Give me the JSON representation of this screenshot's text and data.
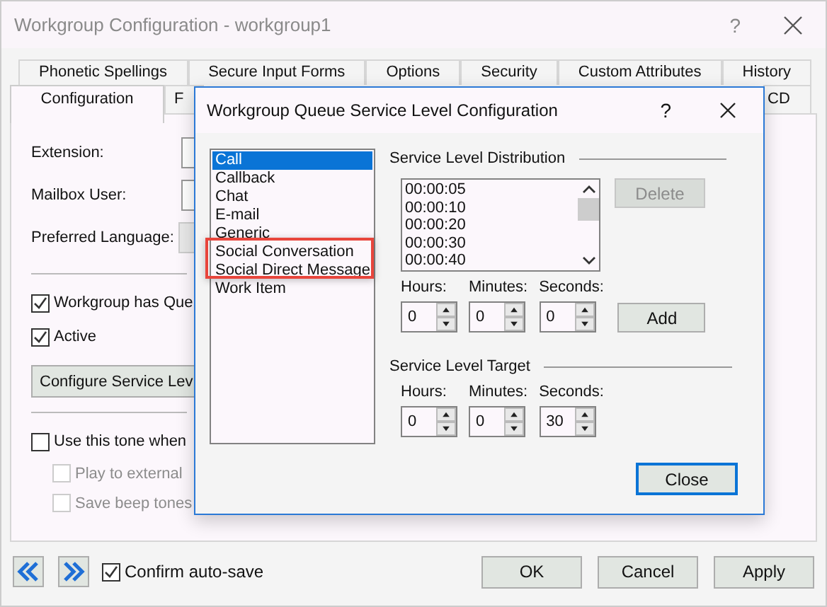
{
  "window": {
    "title": "Workgroup Configuration - workgroup1",
    "help": "?"
  },
  "tabs_row_1": [
    {
      "label": "Phonetic Spellings",
      "selected": false
    },
    {
      "label": "Secure Input Forms",
      "selected": false
    },
    {
      "label": "Options",
      "selected": false
    },
    {
      "label": "Security",
      "selected": false
    },
    {
      "label": "Custom Attributes",
      "selected": false
    },
    {
      "label": "History",
      "selected": false
    }
  ],
  "tabs_row_2": [
    {
      "label": "Configuration",
      "selected": true
    },
    {
      "label": "F",
      "selected": false
    },
    {
      "label": "CD",
      "selected": false
    }
  ],
  "form": {
    "fields": [
      {
        "label": "Extension:",
        "kind": "text"
      },
      {
        "label": "Mailbox User:",
        "kind": "text"
      },
      {
        "label": "Preferred Language:",
        "kind": "dropdown"
      }
    ],
    "checks": [
      {
        "label": "Workgroup has Que",
        "checked": true
      },
      {
        "label": "Active",
        "checked": true
      }
    ],
    "configure_button": "Configure Service Lev",
    "tone": {
      "label": "Use this tone when",
      "checked": false,
      "children": [
        {
          "label": "Play to external",
          "checked": false,
          "disabled": true
        },
        {
          "label": "Save beep tones",
          "checked": false,
          "disabled": true
        }
      ]
    }
  },
  "footer": {
    "confirm_autosave": {
      "label": "Confirm auto-save",
      "checked": true
    },
    "buttons": [
      {
        "label": "OK"
      },
      {
        "label": "Cancel"
      },
      {
        "label": "Apply"
      }
    ]
  },
  "dialog": {
    "title": "Workgroup Queue Service Level Configuration",
    "help": "?",
    "interaction_types": [
      {
        "label": "Call",
        "selected": true
      },
      {
        "label": "Callback",
        "selected": false
      },
      {
        "label": "Chat",
        "selected": false
      },
      {
        "label": "E-mail",
        "selected": false
      },
      {
        "label": "Generic",
        "selected": false
      },
      {
        "label": "Social Conversation",
        "selected": false
      },
      {
        "label": "Social Direct Message",
        "selected": false
      },
      {
        "label": "Work Item",
        "selected": false
      }
    ],
    "distribution": {
      "heading": "Service Level Distribution",
      "times": [
        "00:00:05",
        "00:00:10",
        "00:00:20",
        "00:00:30",
        "00:00:40"
      ],
      "delete": {
        "label": "Delete",
        "disabled": true
      },
      "spinners": [
        {
          "label": "Hours:",
          "value": "0"
        },
        {
          "label": "Minutes:",
          "value": "0"
        },
        {
          "label": "Seconds:",
          "value": "0"
        }
      ],
      "add": {
        "label": "Add",
        "disabled": false
      }
    },
    "target": {
      "heading": "Service Level Target",
      "spinners": [
        {
          "label": "Hours:",
          "value": "0"
        },
        {
          "label": "Minutes:",
          "value": "0"
        },
        {
          "label": "Seconds:",
          "value": "30"
        }
      ]
    },
    "close": {
      "label": "Close",
      "default": true
    }
  }
}
